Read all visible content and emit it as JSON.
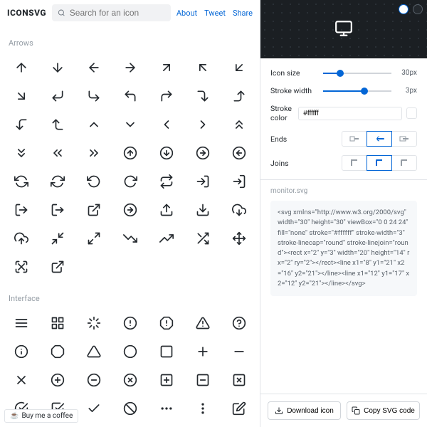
{
  "header": {
    "logo": "ICONSVG",
    "search_placeholder": "Search for an icon",
    "links": {
      "about": "About",
      "tweet": "Tweet",
      "share": "Share"
    }
  },
  "sections": {
    "arrows": "Arrows",
    "interface": "Interface"
  },
  "controls": {
    "size_label": "Icon size",
    "size_value": "30px",
    "size_pct": 25,
    "stroke_label": "Stroke width",
    "stroke_value": "3px",
    "stroke_pct": 60,
    "color_label": "Stroke color",
    "color_value": "#ffffff",
    "ends_label": "Ends",
    "joins_label": "Joins"
  },
  "code": {
    "filename": "monitor.svg",
    "content": "<svg xmlns=\"http://www.w3.org/2000/svg\" width=\"30\" height=\"30\" viewBox=\"0 0 24 24\" fill=\"none\" stroke=\"#ffffff\" stroke-width=\"3\" stroke-linecap=\"round\" stroke-linejoin=\"round\"><rect x=\"2\" y=\"3\" width=\"20\" height=\"14\" rx=\"2\" ry=\"2\"></rect><line x1=\"8\" y1=\"21\" x2=\"16\" y2=\"21\"></line><line x1=\"12\" y1=\"17\" x2=\"12\" y2=\"21\"></line></svg>"
  },
  "actions": {
    "download": "Download icon",
    "copy": "Copy SVG code"
  },
  "footer": {
    "coffee": "Buy me a coffee"
  }
}
